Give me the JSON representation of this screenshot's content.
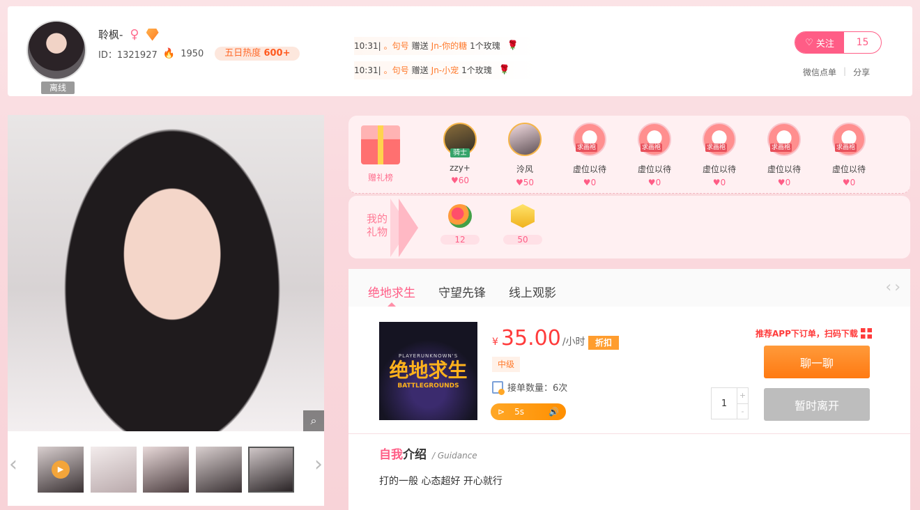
{
  "header": {
    "username": "聆枫-",
    "status": "离线",
    "id_label": "ID：1321927",
    "fire_count": "1950",
    "heat_label": "五日热度",
    "heat_value": "600+",
    "follow_label": "关注",
    "follow_count": "15",
    "wechat_order": "微信点单",
    "share": "分享"
  },
  "gift_feed": [
    {
      "time": "10:31|",
      "from": "。句号",
      "action": "赠送",
      "to": "Jn-你的糖",
      "gift": "1个玫瑰"
    },
    {
      "time": "10:31|",
      "from": "。句号",
      "action": "赠送",
      "to": "Jn-小宠",
      "gift": "1个玫瑰"
    }
  ],
  "rank": {
    "label": "赠礼榜",
    "items": [
      {
        "name": "zzy+",
        "score": "60",
        "tag": "骑士"
      },
      {
        "name": "泠风",
        "score": "50"
      },
      {
        "name": "虚位以待",
        "score": "0",
        "tag": "求画袍"
      },
      {
        "name": "虚位以待",
        "score": "0",
        "tag": "求画袍"
      },
      {
        "name": "虚位以待",
        "score": "0",
        "tag": "求画袍"
      },
      {
        "name": "虚位以待",
        "score": "0",
        "tag": "求画袍"
      },
      {
        "name": "虚位以待",
        "score": "0",
        "tag": "求画袍"
      }
    ],
    "heart": "♥"
  },
  "my_gifts": {
    "label": "我的礼物",
    "items": [
      {
        "icon": "flower-bouquet-icon",
        "count": "12"
      },
      {
        "icon": "medal-icon",
        "count": "50"
      }
    ]
  },
  "games": {
    "tabs": [
      "绝地求生",
      "守望先锋",
      "线上观影"
    ],
    "cover": {
      "small": "PLAYERUNKNOWN'S",
      "title": "绝地求生",
      "sub": "BATTLEGROUNDS"
    },
    "currency": "¥",
    "price": "35.00",
    "unit": "/小时",
    "discount": "折扣",
    "level": "中级",
    "order_count": "接单数量：6次",
    "voice_duration": "5s",
    "app_tip": "推荐APP下订单，扫码下载",
    "quantity": "1",
    "chat_label": "聊一聊",
    "away_label": "暂时离开"
  },
  "intro": {
    "title_a": "自我",
    "title_b": "介绍",
    "slash": "/",
    "subtitle": "Guidance",
    "text": "打的一般 心态超好 开心就行"
  },
  "colors": {
    "accent": "#ff5d86",
    "orange": "#ff7a12",
    "price": "#ff3b3b"
  }
}
